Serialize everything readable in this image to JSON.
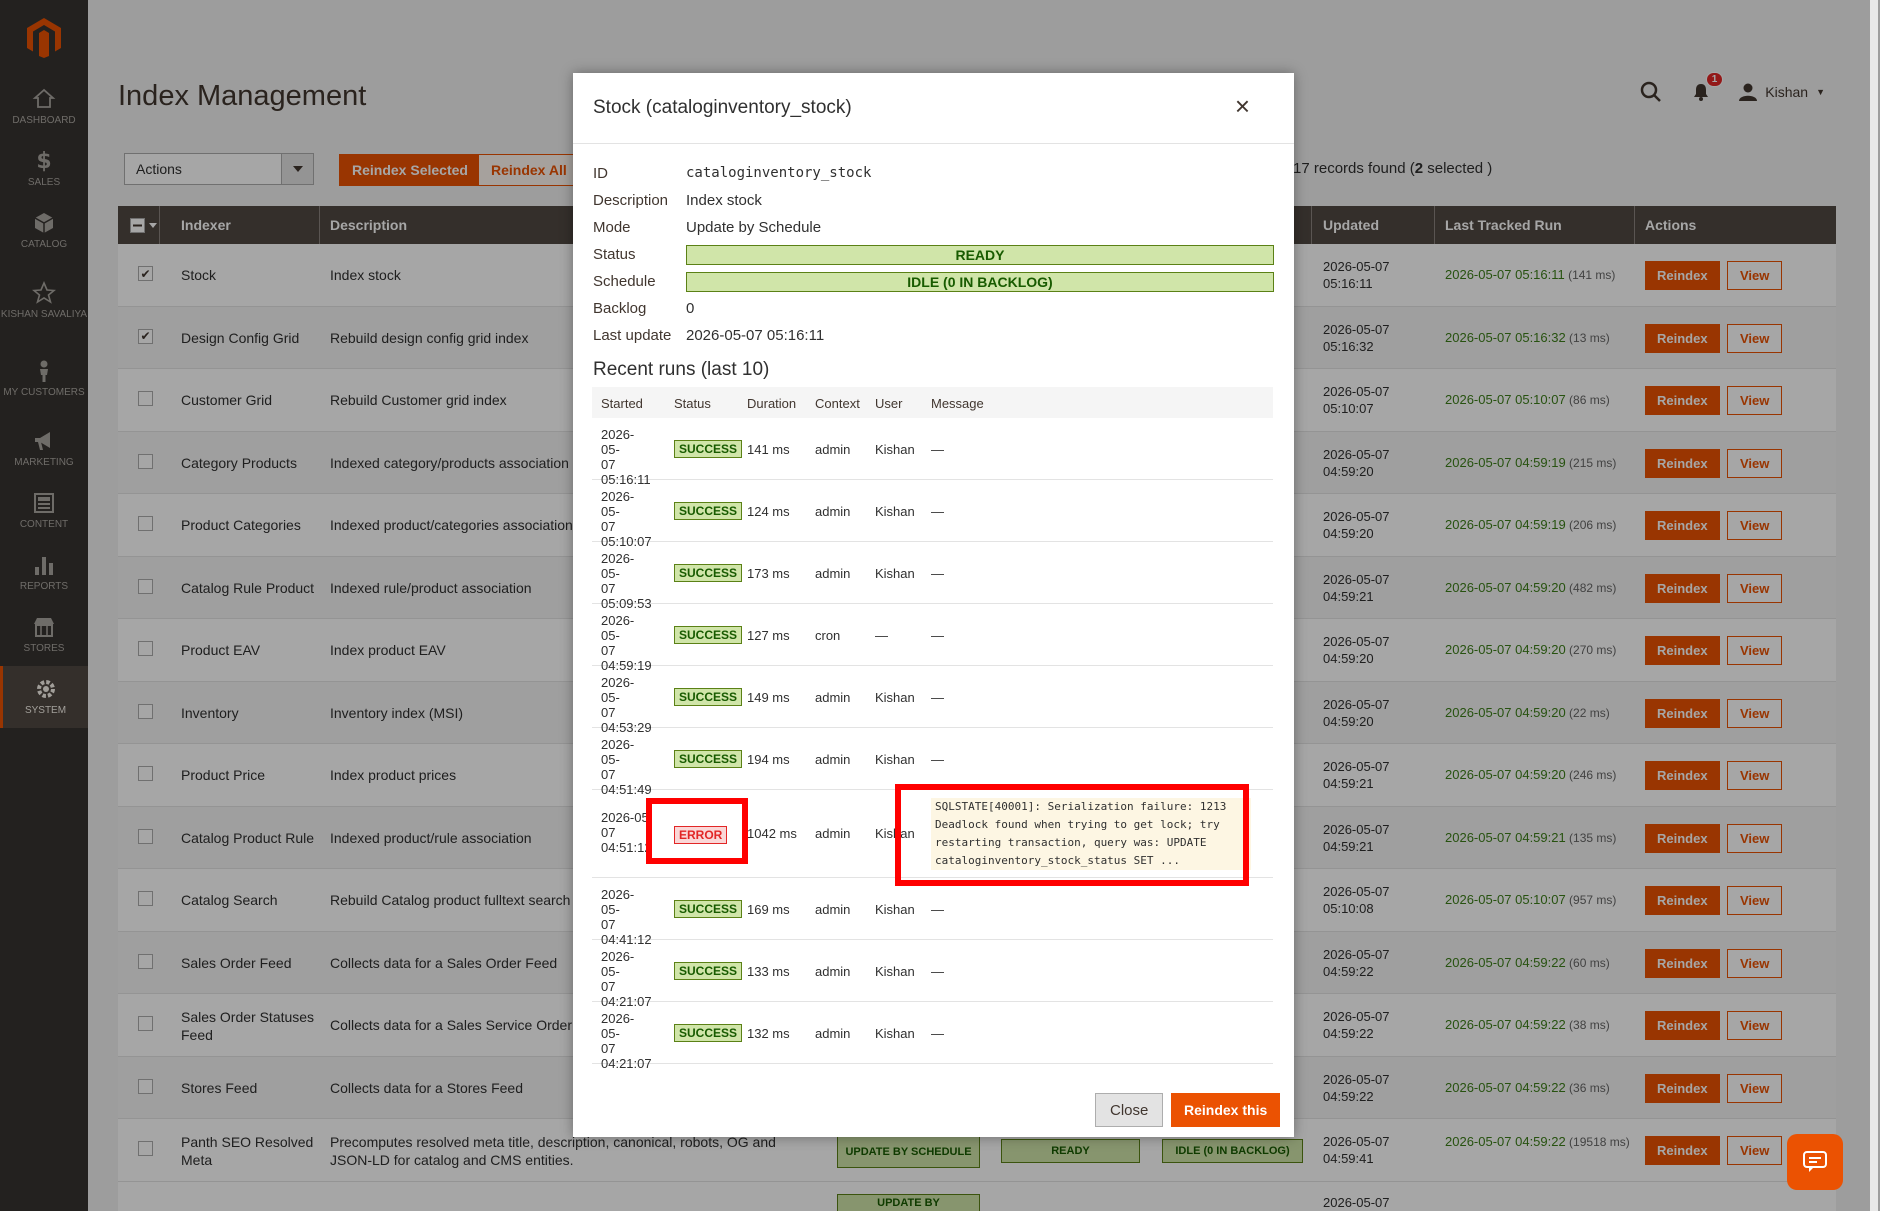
{
  "sidebar": {
    "items": [
      {
        "label": "DASHBOARD",
        "icon": "dashboard-icon"
      },
      {
        "label": "SALES",
        "icon": "dollar-icon"
      },
      {
        "label": "CATALOG",
        "icon": "cube-icon"
      },
      {
        "label": "KISHAN SAVALIYA",
        "icon": "star-icon"
      },
      {
        "label": "MY CUSTOMERS",
        "icon": "person-icon"
      },
      {
        "label": "MARKETING",
        "icon": "megaphone-icon"
      },
      {
        "label": "CONTENT",
        "icon": "content-icon"
      },
      {
        "label": "REPORTS",
        "icon": "bar-chart-icon"
      },
      {
        "label": "STORES",
        "icon": "store-icon"
      },
      {
        "label": "SYSTEM",
        "icon": "gear-icon"
      }
    ]
  },
  "header": {
    "title": "Index Management",
    "user": "Kishan",
    "notifications": "1"
  },
  "toolbar": {
    "actions_label": "Actions",
    "reindex_selected": "Reindex Selected",
    "reindex_all": "Reindex All",
    "records_count": "17",
    "records_mid": " records found (",
    "selected_count": "2",
    "records_end": " selected )"
  },
  "grid": {
    "headers": {
      "indexer": "Indexer",
      "description": "Description",
      "updated": "Updated",
      "last_tracked": "Last Tracked Run",
      "actions": "Actions"
    },
    "reindex_label": "Reindex",
    "view_label": "View",
    "rows": [
      {
        "checked": "✔",
        "indexer": "Stock",
        "description": "Index stock",
        "updated": "2026-05-07\n05:16:11",
        "tracked": "2026-05-07 05:16:11",
        "ms": " (141 ms)"
      },
      {
        "checked": "✔",
        "indexer": "Design Config Grid",
        "description": "Rebuild design config grid index",
        "updated": "2026-05-07\n05:16:32",
        "tracked": "2026-05-07 05:16:32",
        "ms": " (13 ms)"
      },
      {
        "checked": "",
        "indexer": "Customer Grid",
        "description": "Rebuild Customer grid index",
        "updated": "2026-05-07\n05:10:07",
        "tracked": "2026-05-07 05:10:07",
        "ms": " (86 ms)"
      },
      {
        "checked": "",
        "indexer": "Category Products",
        "description": "Indexed category/products association",
        "updated": "2026-05-07\n04:59:20",
        "tracked": "2026-05-07 04:59:19",
        "ms": " (215 ms)"
      },
      {
        "checked": "",
        "indexer": "Product Categories",
        "description": "Indexed product/categories association",
        "updated": "2026-05-07\n04:59:20",
        "tracked": "2026-05-07 04:59:19",
        "ms": " (206 ms)"
      },
      {
        "checked": "",
        "indexer": "Catalog Rule Product",
        "description": "Indexed rule/product association",
        "updated": "2026-05-07\n04:59:21",
        "tracked": "2026-05-07 04:59:20",
        "ms": " (482 ms)"
      },
      {
        "checked": "",
        "indexer": "Product EAV",
        "description": "Index product EAV",
        "updated": "2026-05-07\n04:59:20",
        "tracked": "2026-05-07 04:59:20",
        "ms": " (270 ms)"
      },
      {
        "checked": "",
        "indexer": "Inventory",
        "description": "Inventory index (MSI)",
        "updated": "2026-05-07\n04:59:20",
        "tracked": "2026-05-07 04:59:20",
        "ms": " (22 ms)"
      },
      {
        "checked": "",
        "indexer": "Product Price",
        "description": "Index product prices",
        "updated": "2026-05-07\n04:59:21",
        "tracked": "2026-05-07 04:59:20",
        "ms": " (246 ms)"
      },
      {
        "checked": "",
        "indexer": "Catalog Product Rule",
        "description": "Indexed product/rule association",
        "updated": "2026-05-07\n04:59:21",
        "tracked": "2026-05-07 04:59:21",
        "ms": " (135 ms)"
      },
      {
        "checked": "",
        "indexer": "Catalog Search",
        "description": "Rebuild Catalog product fulltext search i",
        "updated": "2026-05-07\n05:10:08",
        "tracked": "2026-05-07 05:10:07",
        "ms": " (957 ms)"
      },
      {
        "checked": "",
        "indexer": "Sales Order Feed",
        "description": "Collects data for a Sales Order Feed",
        "updated": "2026-05-07\n04:59:22",
        "tracked": "2026-05-07 04:59:22",
        "ms": " (60 ms)"
      },
      {
        "checked": "",
        "indexer": "Sales Order Statuses Feed",
        "description": "Collects data for a Sales Service Order St",
        "updated": "2026-05-07\n04:59:22",
        "tracked": "2026-05-07 04:59:22",
        "ms": " (38 ms)"
      },
      {
        "checked": "",
        "indexer": "Stores Feed",
        "description": "Collects data for a Stores Feed",
        "updated": "2026-05-07\n04:59:22",
        "tracked": "2026-05-07 04:59:22",
        "ms": " (36 ms)"
      },
      {
        "checked": "",
        "indexer": "Panth SEO Resolved Meta",
        "description": "Precomputes resolved meta title, description, canonical, robots, OG and JSON-LD for catalog and CMS entities.",
        "updated": "2026-05-07\n04:59:41",
        "tracked": "2026-05-07 04:59:22",
        "ms": " (19518 ms)"
      }
    ],
    "panth_mode": "UPDATE BY SCHEDULE",
    "panth_status": "READY",
    "panth_schedule": "IDLE (0 IN BACKLOG)",
    "partial_mode": "UPDATE BY",
    "partial_updated": "2026-05-07"
  },
  "modal": {
    "title": "Stock (cataloginventory_stock)",
    "close_icon": "×",
    "info": {
      "id_label": "ID",
      "id": "cataloginventory_stock",
      "desc_label": "Description",
      "desc": "Index stock",
      "mode_label": "Mode",
      "mode": "Update by Schedule",
      "status_label": "Status",
      "status": "READY",
      "schedule_label": "Schedule",
      "schedule": "IDLE (0 IN BACKLOG)",
      "backlog_label": "Backlog",
      "backlog": "0",
      "last_update_label": "Last update",
      "last_update": "2026-05-07 05:16:11"
    },
    "runs_title": "Recent runs (last 10)",
    "runs_headers": {
      "started": "Started",
      "status": "Status",
      "duration": "Duration",
      "context": "Context",
      "user": "User",
      "message": "Message"
    },
    "runs": [
      {
        "started": "2026-05-\n07\n05:16:11",
        "status": "SUCCESS",
        "duration": "141 ms",
        "context": "admin",
        "user": "Kishan",
        "message": "—"
      },
      {
        "started": "2026-05-\n07\n05:10:07",
        "status": "SUCCESS",
        "duration": "124 ms",
        "context": "admin",
        "user": "Kishan",
        "message": "—"
      },
      {
        "started": "2026-05-\n07\n05:09:53",
        "status": "SUCCESS",
        "duration": "173 ms",
        "context": "admin",
        "user": "Kishan",
        "message": "—"
      },
      {
        "started": "2026-05-\n07\n04:59:19",
        "status": "SUCCESS",
        "duration": "127 ms",
        "context": "cron",
        "user": "—",
        "message": "—"
      },
      {
        "started": "2026-05-\n07\n04:53:29",
        "status": "SUCCESS",
        "duration": "149 ms",
        "context": "admin",
        "user": "Kishan",
        "message": "—"
      },
      {
        "started": "2026-05-\n07\n04:51:49",
        "status": "SUCCESS",
        "duration": "194 ms",
        "context": "admin",
        "user": "Kishan",
        "message": "—"
      },
      {
        "started": "2026-05\n07\n04:51:12",
        "status": "ERROR",
        "duration": "1042 ms",
        "context": "admin",
        "user": "Kishan",
        "message": "SQLSTATE[40001]: Serialization failure: 1213 Deadlock found when trying to get lock; try restarting transaction, query was: UPDATE cataloginventory_stock_status SET ..."
      },
      {
        "started": "2026-05-\n07\n04:41:12",
        "status": "SUCCESS",
        "duration": "169 ms",
        "context": "admin",
        "user": "Kishan",
        "message": "—"
      },
      {
        "started": "2026-05-\n07\n04:21:07",
        "status": "SUCCESS",
        "duration": "133 ms",
        "context": "admin",
        "user": "Kishan",
        "message": "—"
      },
      {
        "started": "2026-05-\n07\n04:21:07",
        "status": "SUCCESS",
        "duration": "132 ms",
        "context": "admin",
        "user": "Kishan",
        "message": "—"
      }
    ],
    "close_label": "Close",
    "reindex_label": "Reindex this"
  },
  "colors": {
    "accent": "#eb5202",
    "success_bg": "#d0e5a9",
    "error": "#e22626",
    "highlight": "#ff0000"
  }
}
